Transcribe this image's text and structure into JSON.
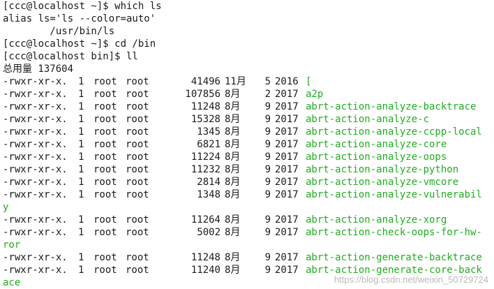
{
  "prompt_lines": [
    "[ccc@localhost ~]$ which ls",
    "alias ls='ls --color=auto'",
    "        /usr/bin/ls",
    "[ccc@localhost ~]$ cd /bin",
    "[ccc@localhost bin]$ ll",
    "总用量 137604"
  ],
  "listing": [
    {
      "perm": "-rwxr-xr-x.",
      "links": "1",
      "owner": "root",
      "group": "root",
      "size": "41496",
      "month": "11月",
      "day": "5",
      "year": "2016",
      "name": "[",
      "cont": ""
    },
    {
      "perm": "-rwxr-xr-x.",
      "links": "1",
      "owner": "root",
      "group": "root",
      "size": "107856",
      "month": "8月",
      "day": "2",
      "year": "2017",
      "name": "a2p",
      "cont": ""
    },
    {
      "perm": "-rwxr-xr-x.",
      "links": "1",
      "owner": "root",
      "group": "root",
      "size": "11248",
      "month": "8月",
      "day": "9",
      "year": "2017",
      "name": "abrt-action-analyze-backtrace",
      "cont": ""
    },
    {
      "perm": "-rwxr-xr-x.",
      "links": "1",
      "owner": "root",
      "group": "root",
      "size": "15328",
      "month": "8月",
      "day": "9",
      "year": "2017",
      "name": "abrt-action-analyze-c",
      "cont": ""
    },
    {
      "perm": "-rwxr-xr-x.",
      "links": "1",
      "owner": "root",
      "group": "root",
      "size": "1345",
      "month": "8月",
      "day": "9",
      "year": "2017",
      "name": "abrt-action-analyze-ccpp-local",
      "cont": ""
    },
    {
      "perm": "-rwxr-xr-x.",
      "links": "1",
      "owner": "root",
      "group": "root",
      "size": "6821",
      "month": "8月",
      "day": "9",
      "year": "2017",
      "name": "abrt-action-analyze-core",
      "cont": ""
    },
    {
      "perm": "-rwxr-xr-x.",
      "links": "1",
      "owner": "root",
      "group": "root",
      "size": "11224",
      "month": "8月",
      "day": "9",
      "year": "2017",
      "name": "abrt-action-analyze-oops",
      "cont": ""
    },
    {
      "perm": "-rwxr-xr-x.",
      "links": "1",
      "owner": "root",
      "group": "root",
      "size": "11232",
      "month": "8月",
      "day": "9",
      "year": "2017",
      "name": "abrt-action-analyze-python",
      "cont": ""
    },
    {
      "perm": "-rwxr-xr-x.",
      "links": "1",
      "owner": "root",
      "group": "root",
      "size": "2814",
      "month": "8月",
      "day": "9",
      "year": "2017",
      "name": "abrt-action-analyze-vmcore",
      "cont": ""
    },
    {
      "perm": "-rwxr-xr-x.",
      "links": "1",
      "owner": "root",
      "group": "root",
      "size": "1348",
      "month": "8月",
      "day": "9",
      "year": "2017",
      "name": "abrt-action-analyze-vulnerabil",
      "cont": "y"
    },
    {
      "perm": "-rwxr-xr-x.",
      "links": "1",
      "owner": "root",
      "group": "root",
      "size": "11264",
      "month": "8月",
      "day": "9",
      "year": "2017",
      "name": "abrt-action-analyze-xorg",
      "cont": ""
    },
    {
      "perm": "-rwxr-xr-x.",
      "links": "1",
      "owner": "root",
      "group": "root",
      "size": "5002",
      "month": "8月",
      "day": "9",
      "year": "2017",
      "name": "abrt-action-check-oops-for-hw-",
      "cont": "ror"
    },
    {
      "perm": "-rwxr-xr-x.",
      "links": "1",
      "owner": "root",
      "group": "root",
      "size": "11248",
      "month": "8月",
      "day": "9",
      "year": "2017",
      "name": "abrt-action-generate-backtrace",
      "cont": ""
    },
    {
      "perm": "-rwxr-xr-x.",
      "links": "1",
      "owner": "root",
      "group": "root",
      "size": "11240",
      "month": "8月",
      "day": "9",
      "year": "2017",
      "name": "abrt-action-generate-core-back",
      "cont": "ace"
    }
  ],
  "watermark": "https://blog.csdn.net/weixin_50729724",
  "colors": {
    "executable": "#1fae1f",
    "text": "#1a1a1a",
    "background": "#ffffff"
  }
}
